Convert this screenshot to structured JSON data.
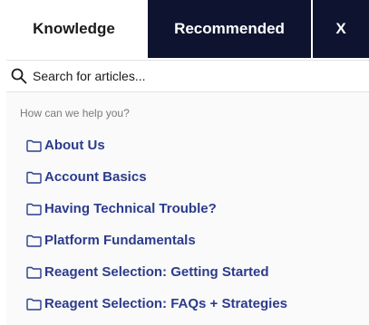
{
  "tabs": {
    "knowledge": "Knowledge",
    "recommended": "Recommended",
    "close": "X"
  },
  "search": {
    "placeholder": "Search for articles...",
    "icon": "search-icon"
  },
  "help_text": "How can we help you?",
  "categories": [
    {
      "label": "About Us",
      "icon": "folder-icon"
    },
    {
      "label": "Account Basics",
      "icon": "folder-icon"
    },
    {
      "label": "Having Technical Trouble?",
      "icon": "folder-icon"
    },
    {
      "label": "Platform Fundamentals",
      "icon": "folder-icon"
    },
    {
      "label": "Reagent Selection: Getting Started",
      "icon": "folder-icon"
    },
    {
      "label": "Reagent Selection: FAQs + Strategies",
      "icon": "folder-icon"
    }
  ],
  "colors": {
    "header_dark": "#0e1430",
    "link": "#2b3c8c",
    "muted_text": "#7a7a7a"
  }
}
